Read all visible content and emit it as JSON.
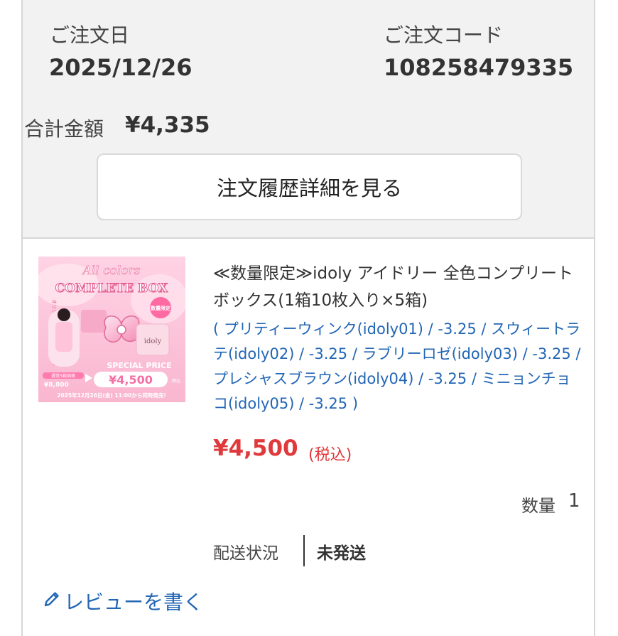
{
  "order": {
    "date_label": "ご注文日",
    "date_value": "2025/12/26",
    "code_label": "ご注文コード",
    "code_value": "108258479335",
    "total_label": "合計金額",
    "total_value": "¥4,335",
    "detail_button": "注文履歴詳細を見る"
  },
  "item": {
    "image": {
      "script_title": "All colors",
      "title": "COMPLETE BOX",
      "badge": "数量限定",
      "brand": "idoly",
      "side_text": "オリジナルキーホルダー付き!",
      "banner": "SPECIAL PRICE",
      "regular_label": "通常5箱価格",
      "regular_price": "¥8,800",
      "special_price": "¥4,500",
      "tax_note": "税込",
      "release": "2025年12月26日(金) 11:00から同時発売!",
      "accent_color": "#f56fa6"
    },
    "name": "≪数量限定≫idoly アイドリー 全色コンプリートボックス(1箱10枚入り×5箱)",
    "variants": "( プリティーウィンク(idoly01) / -3.25 / スウィートラテ(idoly02) / -3.25 / ラブリーロゼ(idoly03) / -3.25 / プレシャスブラウン(idoly04) / -3.25 / ミニョンチョコ(idoly05) / -3.25 )",
    "price": "¥4,500",
    "tax": "(税込)",
    "quantity_label": "数量",
    "quantity_value": "1",
    "shipping_label": "配送状況",
    "shipping_value": "未発送",
    "review_label": "レビューを書く",
    "review_icon": "pencil-icon"
  },
  "colors": {
    "price": "#e0393b",
    "link": "#2266b5",
    "summary_bg": "#f2f2f2"
  }
}
